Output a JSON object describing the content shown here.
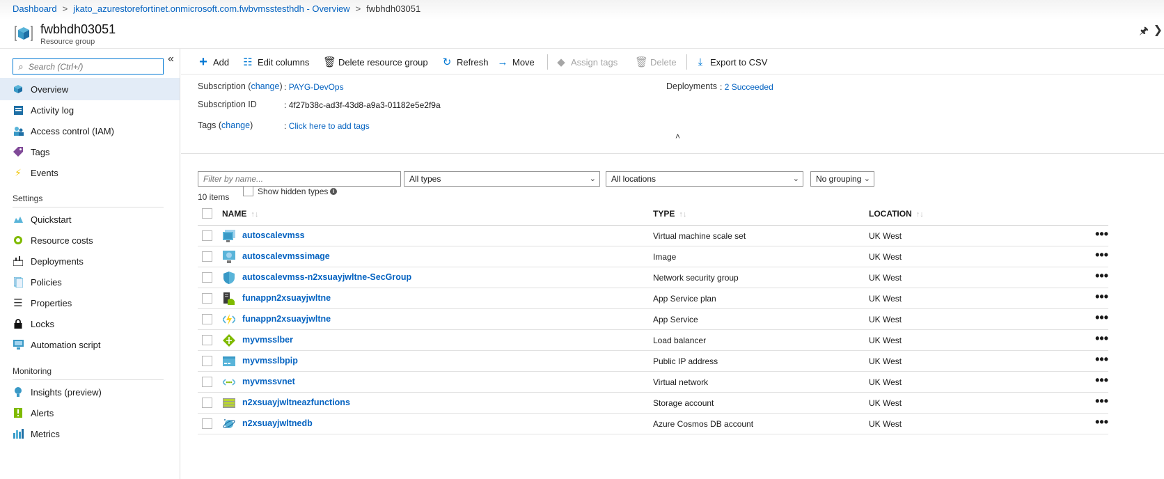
{
  "breadcrumb": {
    "items": [
      "Dashboard",
      "jkato_azurestorefortinet.onmicrosoft.com.fwbvmsstesthdh - Overview",
      "fwbhdh03051"
    ]
  },
  "header": {
    "title": "fwbhdh03051",
    "subtitle": "Resource group"
  },
  "sidebar": {
    "search_placeholder": "Search (Ctrl+/)",
    "items": [
      {
        "label": "Overview",
        "icon": "overview-icon"
      },
      {
        "label": "Activity log",
        "icon": "activity-log-icon"
      },
      {
        "label": "Access control (IAM)",
        "icon": "iam-icon"
      },
      {
        "label": "Tags",
        "icon": "tag-icon"
      },
      {
        "label": "Events",
        "icon": "lightning-icon"
      }
    ],
    "settings_heading": "Settings",
    "settings_items": [
      {
        "label": "Quickstart",
        "icon": "quickstart-icon"
      },
      {
        "label": "Resource costs",
        "icon": "cost-icon"
      },
      {
        "label": "Deployments",
        "icon": "deployments-icon"
      },
      {
        "label": "Policies",
        "icon": "policies-icon"
      },
      {
        "label": "Properties",
        "icon": "properties-icon"
      },
      {
        "label": "Locks",
        "icon": "lock-icon"
      },
      {
        "label": "Automation script",
        "icon": "automation-icon"
      }
    ],
    "monitoring_heading": "Monitoring",
    "monitoring_items": [
      {
        "label": "Insights (preview)",
        "icon": "insights-icon"
      },
      {
        "label": "Alerts",
        "icon": "alerts-icon"
      },
      {
        "label": "Metrics",
        "icon": "metrics-icon"
      }
    ]
  },
  "toolbar": {
    "add": "Add",
    "edit_columns": "Edit columns",
    "delete_group": "Delete resource group",
    "refresh": "Refresh",
    "move": "Move",
    "assign_tags": "Assign tags",
    "delete": "Delete",
    "export": "Export to CSV"
  },
  "essentials": {
    "subscription_label": "Subscription (",
    "change": "change",
    "subscription_label_end": ")",
    "subscription_value": "PAYG-DevOps",
    "subscription_id_label": "Subscription ID",
    "subscription_id_value": "4f27b38c-ad3f-43d8-a9a3-01182e5e2f9a",
    "tags_label": "Tags (",
    "tags_label_end": ")",
    "tags_value": "Click here to add tags",
    "deployments_label": "Deployments",
    "deployments_value": "2 Succeeded",
    "colon": ":"
  },
  "filters": {
    "name_placeholder": "Filter by name...",
    "types": "All types",
    "locations": "All locations",
    "grouping": "No grouping",
    "item_count": "10 items",
    "show_hidden": "Show hidden types"
  },
  "table": {
    "columns": [
      "NAME",
      "TYPE",
      "LOCATION"
    ],
    "rows": [
      {
        "name": "autoscalevmss",
        "type": "Virtual machine scale set",
        "location": "UK West",
        "icon": "vmss-icon"
      },
      {
        "name": "autoscalevmssimage",
        "type": "Image",
        "location": "UK West",
        "icon": "image-icon"
      },
      {
        "name": "autoscalevmss-n2xsuayjwltne-SecGroup",
        "type": "Network security group",
        "location": "UK West",
        "icon": "nsg-shield-icon"
      },
      {
        "name": "funappn2xsuayjwltne",
        "type": "App Service plan",
        "location": "UK West",
        "icon": "app-service-plan-icon"
      },
      {
        "name": "funappn2xsuayjwltne",
        "type": "App Service",
        "location": "UK West",
        "icon": "function-app-icon"
      },
      {
        "name": "myvmsslber",
        "type": "Load balancer",
        "location": "UK West",
        "icon": "load-balancer-icon"
      },
      {
        "name": "myvmsslbpip",
        "type": "Public IP address",
        "location": "UK West",
        "icon": "public-ip-icon"
      },
      {
        "name": "myvmssvnet",
        "type": "Virtual network",
        "location": "UK West",
        "icon": "vnet-icon"
      },
      {
        "name": "n2xsuayjwltneazfunctions",
        "type": "Storage account",
        "location": "UK West",
        "icon": "storage-icon"
      },
      {
        "name": "n2xsuayjwltnedb",
        "type": "Azure Cosmos DB account",
        "location": "UK West",
        "icon": "cosmos-db-icon"
      }
    ],
    "more_label": "•••"
  }
}
